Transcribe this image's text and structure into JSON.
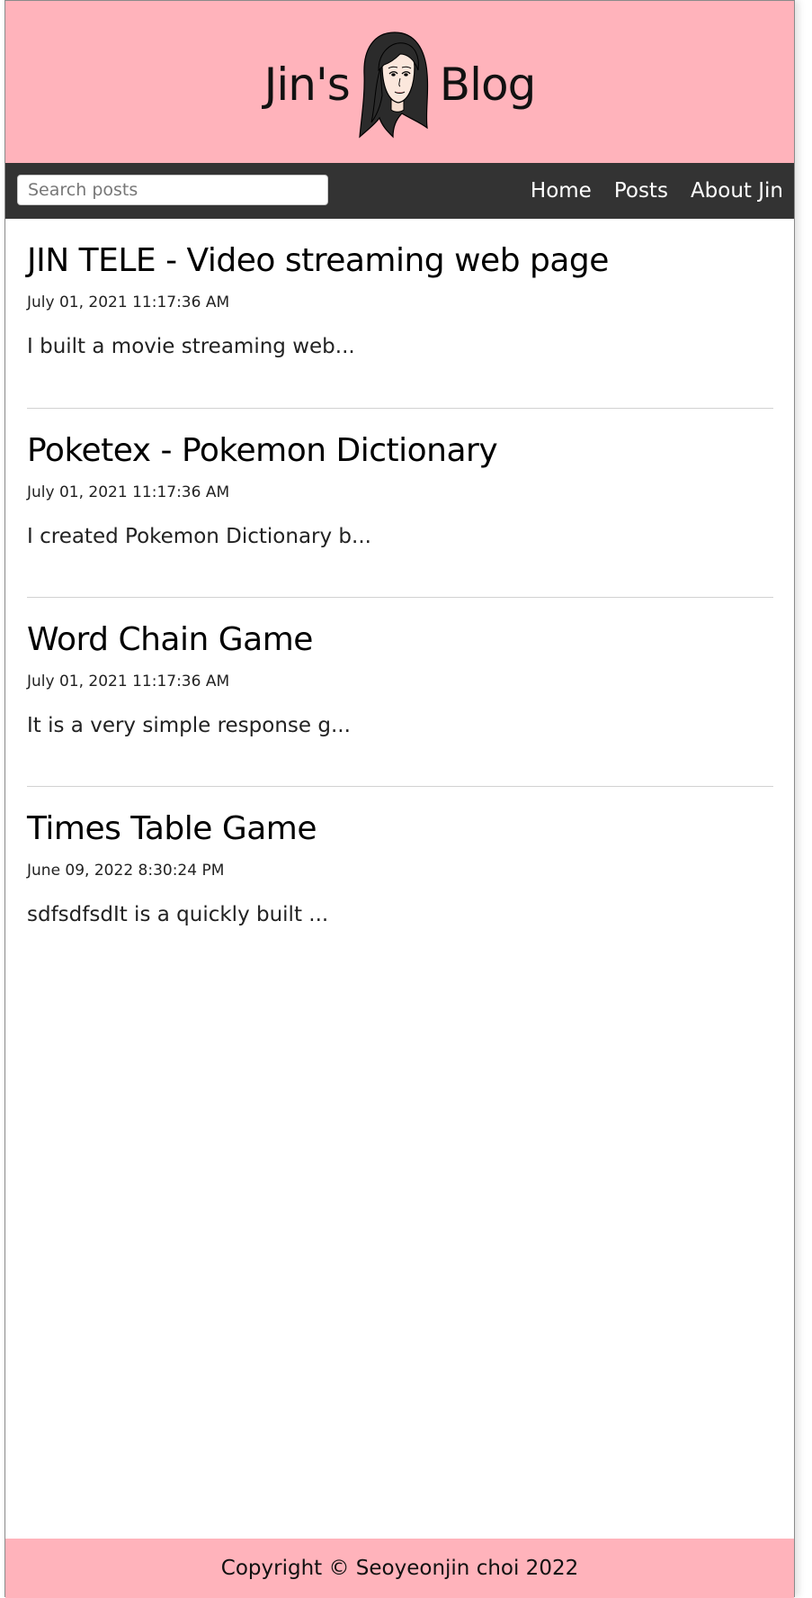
{
  "header": {
    "title_left": "Jin's",
    "title_right": "Blog",
    "avatar_icon": "avatar-girl-illustration",
    "background": "#ffb3bb"
  },
  "navbar": {
    "search_placeholder": "Search posts",
    "links": [
      {
        "label": "Home"
      },
      {
        "label": "Posts"
      },
      {
        "label": "About Jin"
      }
    ],
    "background": "#333333"
  },
  "posts": [
    {
      "title": "JIN TELE - Video streaming web page",
      "date": "July 01, 2021 11:17:36 AM",
      "excerpt": "I built a movie streaming web..."
    },
    {
      "title": "Poketex - Pokemon Dictionary",
      "date": "July 01, 2021 11:17:36 AM",
      "excerpt": "I created Pokemon Dictionary b..."
    },
    {
      "title": "Word Chain Game",
      "date": "July 01, 2021 11:17:36 AM",
      "excerpt": "It is a very simple response g..."
    },
    {
      "title": "Times Table Game",
      "date": "June 09, 2022 8:30:24 PM",
      "excerpt": "sdfsdfsdIt is a quickly built ..."
    }
  ],
  "footer": {
    "copyright": "Copyright © Seoyeonjin choi 2022"
  }
}
